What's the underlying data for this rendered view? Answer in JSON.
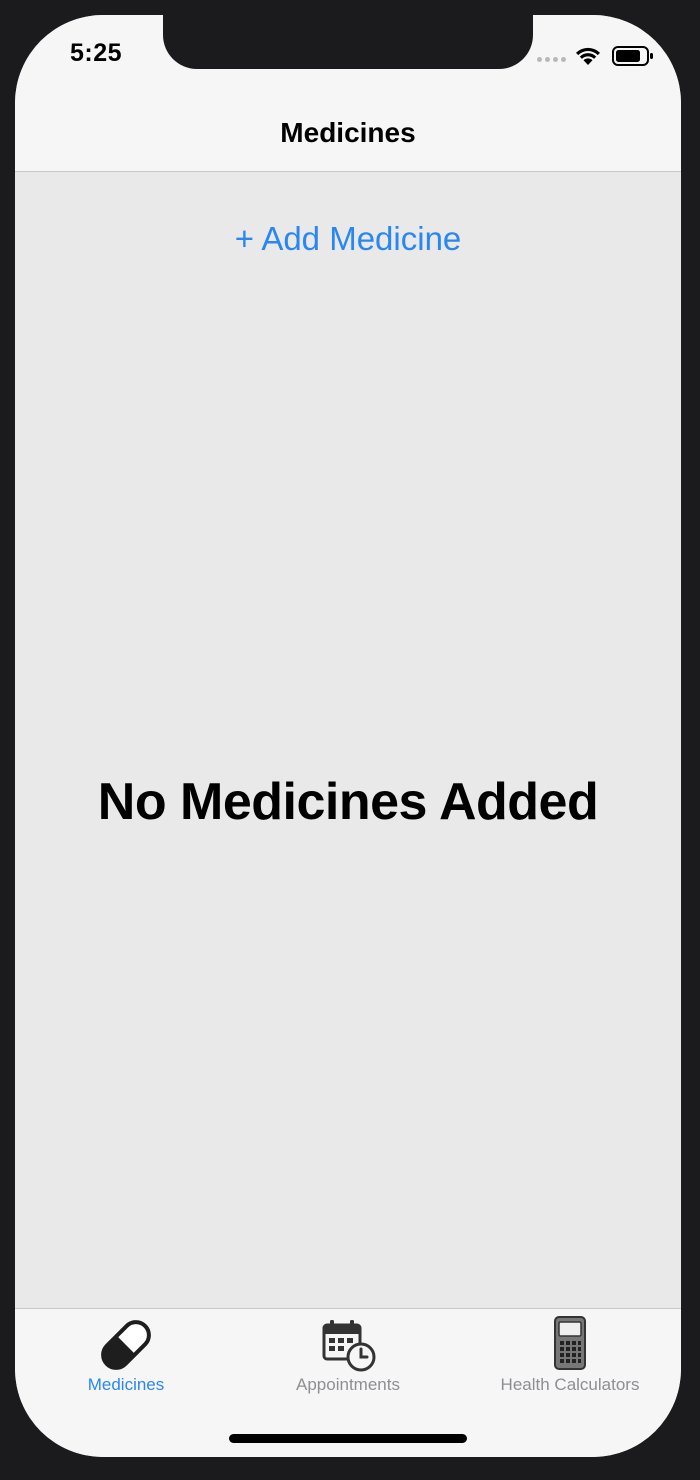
{
  "status_bar": {
    "time": "5:25",
    "icons": [
      "signal-icon",
      "wifi-icon",
      "battery-icon"
    ]
  },
  "nav": {
    "title": "Medicines"
  },
  "content": {
    "add_button_label": "+ Add Medicine",
    "empty_message": "No Medicines Added"
  },
  "tabs": [
    {
      "label": "Medicines",
      "icon": "pill-icon",
      "active": true
    },
    {
      "label": "Appointments",
      "icon": "calendar-clock-icon",
      "active": false
    },
    {
      "label": "Health Calculators",
      "icon": "calculator-icon",
      "active": false
    }
  ],
  "colors": {
    "accent": "#2a87ef",
    "inactive_tab": "#8e8e93",
    "content_background": "#e9e9ea",
    "bar_background": "#f6f6f7"
  }
}
